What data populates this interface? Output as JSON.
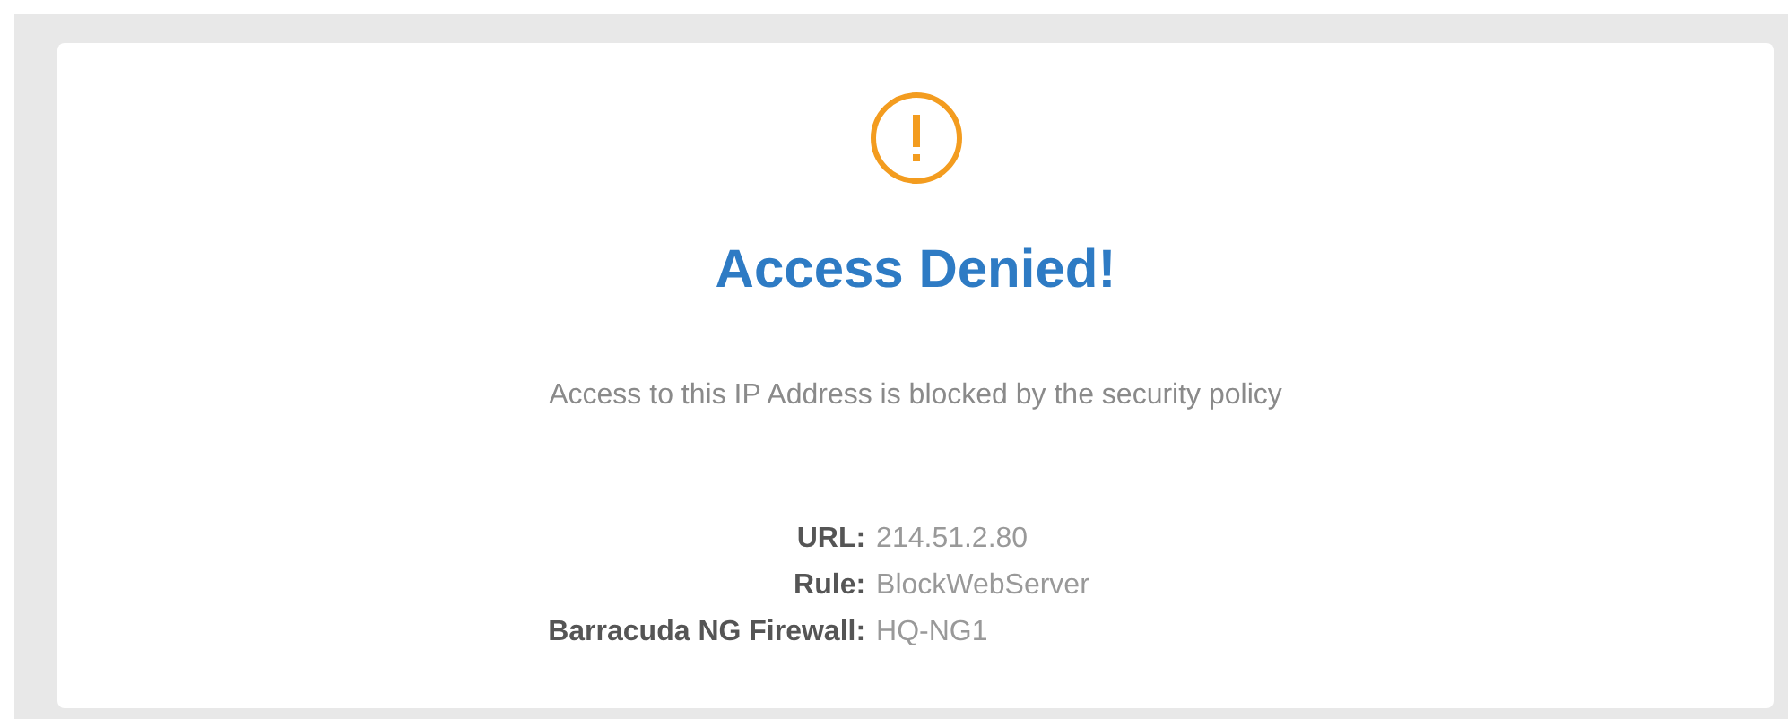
{
  "title": "Access Denied!",
  "message": "Access to this IP Address is blocked by the security policy",
  "details": [
    {
      "label": "URL:",
      "value": "214.51.2.80"
    },
    {
      "label": "Rule:",
      "value": "BlockWebServer"
    },
    {
      "label": "Barracuda NG Firewall:",
      "value": "HQ-NG1"
    }
  ]
}
